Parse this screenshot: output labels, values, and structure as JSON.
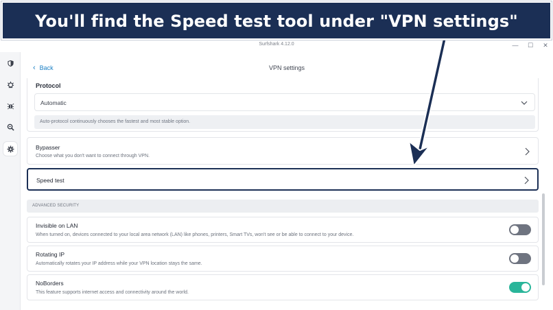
{
  "banner": {
    "text": "You'll find the Speed test tool under \"VPN settings\""
  },
  "window": {
    "title": "Surfshark 4.12.0",
    "controls": [
      "—",
      "☐",
      "✕"
    ]
  },
  "rail": {
    "items": [
      {
        "icon": "shield-icon"
      },
      {
        "icon": "alert-bug-icon"
      },
      {
        "icon": "antivirus-icon"
      },
      {
        "icon": "search-zoom-icon"
      },
      {
        "icon": "gear-icon",
        "active": true
      }
    ]
  },
  "header": {
    "back_label": "Back",
    "title": "VPN settings"
  },
  "protocol": {
    "label": "Protocol",
    "value": "Automatic",
    "help": "Auto-protocol continuously chooses the fastest and most stable option."
  },
  "bypasser": {
    "title": "Bypasser",
    "description": "Choose what you don't want to connect through VPN."
  },
  "speed_test": {
    "title": "Speed test"
  },
  "advanced_security": {
    "heading": "ADVANCED SECURITY",
    "items": [
      {
        "title": "Invisible on LAN",
        "description": "When turned on, devices connected to your local area network (LAN) like phones, printers, Smart TVs, won't see or be able to connect to your device.",
        "enabled": false
      },
      {
        "title": "Rotating IP",
        "description": "Automatically rotates your IP address while your VPN location stays the same.",
        "enabled": false
      },
      {
        "title": "NoBorders",
        "description": "This feature supports internet access and connectivity around the world.",
        "enabled": true
      }
    ]
  },
  "colors": {
    "banner": "#1b2f55",
    "link": "#1a7fc4",
    "toggle_on": "#2ab59a",
    "toggle_off": "#6f7480"
  }
}
